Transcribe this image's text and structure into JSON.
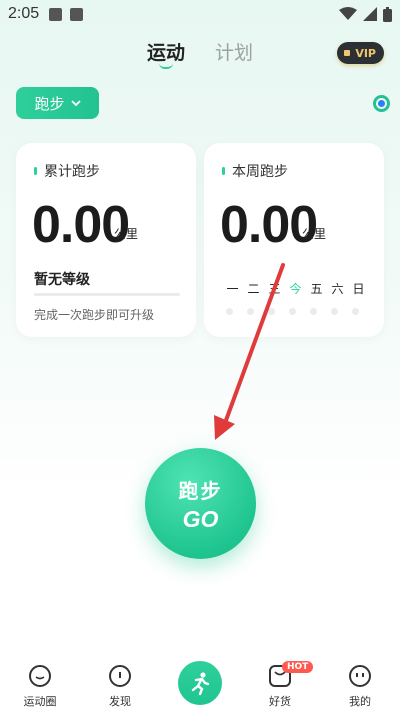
{
  "status": {
    "time": "2:05"
  },
  "tabs": [
    {
      "label": "运动",
      "active": true
    },
    {
      "label": "计划",
      "active": false
    }
  ],
  "vip": {
    "label": "VIP"
  },
  "sport_type": {
    "label": "跑步"
  },
  "total_card": {
    "title": "累计跑步",
    "value": "0.00",
    "unit": "公里",
    "level": "暂无等级",
    "progress": 0,
    "hint": "完成一次跑步即可升级"
  },
  "week_card": {
    "title": "本周跑步",
    "value": "0.00",
    "unit": "公里",
    "days": [
      "一",
      "二",
      "三",
      "今",
      "五",
      "六",
      "日"
    ]
  },
  "go_button": {
    "line1": "跑步",
    "line2": "GO"
  },
  "nav": {
    "items": [
      {
        "label": "运动圈"
      },
      {
        "label": "发现"
      },
      {
        "label": ""
      },
      {
        "label": "好货",
        "badge": "HOT"
      },
      {
        "label": "我的"
      }
    ]
  },
  "colors": {
    "accent": "#2fcf9c",
    "arrow": "#e03b3b",
    "hot": "#ff5a4f"
  }
}
